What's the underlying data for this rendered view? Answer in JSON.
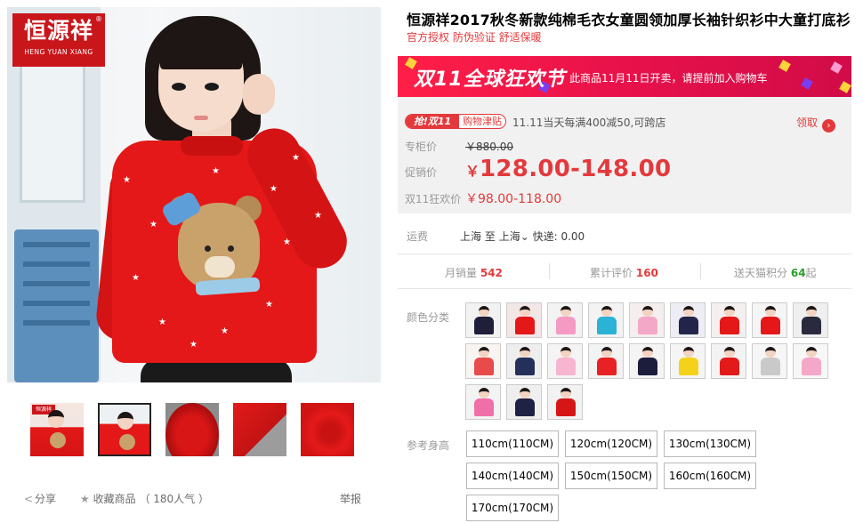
{
  "brand": {
    "logo_cn": "恒源祥",
    "logo_en": "HENG YUAN XIANG",
    "registered_mark": "®",
    "color": "#c9161b"
  },
  "gallery": {
    "thumbnails": [
      {
        "name": "thumb-1",
        "badge": "恒源祥",
        "selected": false
      },
      {
        "name": "thumb-2",
        "badge": "",
        "selected": true
      },
      {
        "name": "thumb-3",
        "badge": "",
        "selected": false
      },
      {
        "name": "thumb-4",
        "badge": "",
        "selected": false
      },
      {
        "name": "thumb-5",
        "badge": "",
        "selected": false
      }
    ],
    "share_label": "分享",
    "favorite_label": "收藏商品",
    "favorite_count": "（ 180人气 ）",
    "report_label": "举报"
  },
  "product": {
    "title": "恒源祥2017秋冬新款纯棉毛衣女童圆领加厚长袖针织衫中大童打底衫",
    "subtitle": "官方授权 防伪验证 舒适保暖"
  },
  "promo_banner": {
    "title": "双11全球狂欢节",
    "text": "此商品11月11日开卖，请提前加入购物车",
    "accent_color": "#e8114a"
  },
  "price_box": {
    "coupon_tag_main": "抢!双11",
    "coupon_tag_sub": "购物津贴",
    "coupon_text": "11.11当天每满400减50,可跨店",
    "coupon_action": "领取",
    "coupon_action_icon": "arrow-right-circle-icon",
    "list_price_label": "专柜价",
    "list_price": "￥880.00",
    "promo_price_label": "促销价",
    "promo_price_currency": "￥",
    "promo_price": "128.00-148.00",
    "event_price_label": "双11狂欢价",
    "event_price": "￥98.00-118.00",
    "price_color": "#e4393c"
  },
  "shipping": {
    "label": "运费",
    "from": "上海",
    "to_word": "至",
    "to": "上海",
    "dropdown_icon": "chevron-down-icon",
    "method": "快递: 0.00"
  },
  "stats": [
    {
      "label": "月销量",
      "value": "542",
      "suffix": ""
    },
    {
      "label": "累计评价",
      "value": "160",
      "suffix": ""
    },
    {
      "label": "送天猫积分",
      "value": "64",
      "suffix": "起"
    }
  ],
  "colors": {
    "label": "颜色分类",
    "swatches": [
      {
        "body": "#1f1f3a",
        "bg": "#f2f2f2"
      },
      {
        "body": "#e41818",
        "bg": "#f2e6e6"
      },
      {
        "body": "#f59ac3",
        "bg": "#f3f3f3"
      },
      {
        "body": "#2bb3d6",
        "bg": "#f3f3f3"
      },
      {
        "body": "#f3a8c8",
        "bg": "#f5eeee"
      },
      {
        "body": "#24234a",
        "bg": "#ededf5"
      },
      {
        "body": "#e41818",
        "bg": "#f5f0f0"
      },
      {
        "body": "#e41818",
        "bg": "#f5f5f5"
      },
      {
        "body": "#2a2a3e",
        "bg": "#f0efef"
      },
      {
        "body": "#e84b4b",
        "bg": "#f8f4f2"
      },
      {
        "body": "#25305a",
        "bg": "#eeeeee"
      },
      {
        "body": "#f7b5d0",
        "bg": "#f4f4f4"
      },
      {
        "body": "#e82222",
        "bg": "#f3f3f3"
      },
      {
        "body": "#1c1c3d",
        "bg": "#f4f4f4"
      },
      {
        "body": "#f5d21a",
        "bg": "#f5f5f5"
      },
      {
        "body": "#e31a1a",
        "bg": "#f3f3f3"
      },
      {
        "body": "#c9c9c9",
        "bg": "#f6f6f6"
      },
      {
        "body": "#f4a7c9",
        "bg": "#f7f7f7"
      },
      {
        "body": "#f06fa8",
        "bg": "#f3f3f3"
      },
      {
        "body": "#1f2244",
        "bg": "#efefef"
      },
      {
        "body": "#d61616",
        "bg": "#f2f2f2"
      }
    ]
  },
  "sizes": {
    "label": "参考身高",
    "options": [
      "110cm(110CM)",
      "120cm(120CM)",
      "130cm(130CM)",
      "140cm(140CM)",
      "150cm(150CM)",
      "160cm(160CM)",
      "170cm(170CM)"
    ]
  }
}
